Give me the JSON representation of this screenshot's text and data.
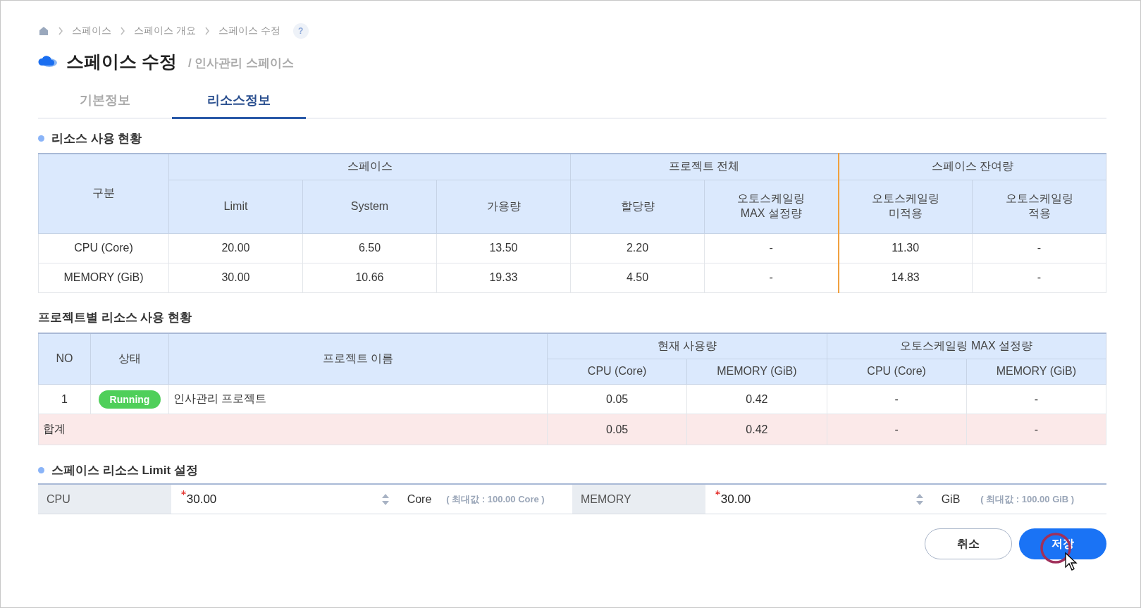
{
  "breadcrumb": {
    "items": [
      "스페이스",
      "스페이스 개요",
      "스페이스 수정"
    ],
    "help": "?"
  },
  "header": {
    "title": "스페이스 수정",
    "subtitle": "/ 인사관리 스페이스"
  },
  "tabs": [
    {
      "label": "기본정보",
      "selected": false
    },
    {
      "label": "리소스정보",
      "selected": true
    }
  ],
  "usage": {
    "title": "리소스 사용 현황",
    "category": "구분",
    "groups": [
      {
        "label": "스페이스",
        "columns": [
          "Limit",
          "System",
          "가용량"
        ]
      },
      {
        "label": "프로젝트 전체",
        "columns": [
          "할당량",
          "오토스케일링\nMAX 설정량"
        ]
      },
      {
        "label": "스페이스 잔여량",
        "columns": [
          "오토스케일링\n미적용",
          "오토스케일링\n적용"
        ]
      }
    ],
    "rows": [
      {
        "label": "CPU (Core)",
        "cells": [
          "20.00",
          "6.50",
          "13.50",
          "2.20",
          "-",
          "11.30",
          "-"
        ]
      },
      {
        "label": "MEMORY (GiB)",
        "cells": [
          "30.00",
          "10.66",
          "19.33",
          "4.50",
          "-",
          "14.83",
          "-"
        ]
      }
    ]
  },
  "projects": {
    "title": "프로젝트별 리소스 사용 현황",
    "no": "NO",
    "status": "상태",
    "name": "프로젝트 이름",
    "groups": [
      {
        "label": "현재 사용량",
        "columns": [
          "CPU (Core)",
          "MEMORY (GiB)"
        ]
      },
      {
        "label": "오토스케일링 MAX 설정량",
        "columns": [
          "CPU (Core)",
          "MEMORY (GiB)"
        ]
      }
    ],
    "rows": [
      {
        "no": "1",
        "status": {
          "label": "Running",
          "kind": "running"
        },
        "name": "인사관리 프로젝트",
        "values": [
          "0.05",
          "0.42",
          "-",
          "-"
        ]
      }
    ],
    "total": {
      "label": "합계",
      "values": [
        "0.05",
        "0.42",
        "-",
        "-"
      ]
    }
  },
  "limits": {
    "title": "스페이스 리소스 Limit 설정",
    "fields": [
      {
        "label": "CPU",
        "value": "30.00",
        "required": true,
        "unit": "Core",
        "max": "( 최대값 :  100.00 Core )"
      },
      {
        "label": "MEMORY",
        "value": "30.00",
        "required": true,
        "unit": "GiB",
        "max": "( 최대값 :  100.00 GiB )"
      }
    ]
  },
  "buttons": [
    {
      "label": "취소",
      "kind": "secondary"
    },
    {
      "label": "저장",
      "kind": "primary"
    }
  ]
}
